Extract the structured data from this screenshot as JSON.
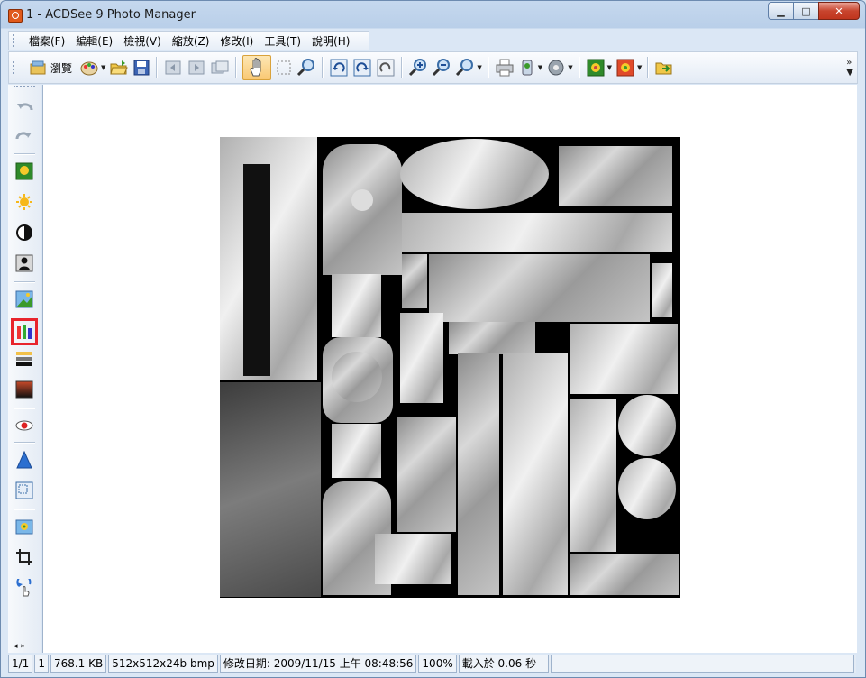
{
  "window": {
    "title": "1 - ACDSee 9 Photo Manager",
    "buttons": {
      "minimize": "▁",
      "maximize": "□",
      "close": "✕"
    }
  },
  "menu": [
    "檔案(F)",
    "編輯(E)",
    "檢視(V)",
    "縮放(Z)",
    "修改(I)",
    "工具(T)",
    "說明(H)"
  ],
  "toolbar": {
    "browse_label": "瀏覽",
    "icons": [
      "browse-icon",
      "palette-icon",
      "open-folder-icon",
      "save-icon",
      "prev-image-icon",
      "next-image-icon",
      "slideshow-icon",
      "hand-tool-icon",
      "select-tool-icon",
      "magnifier-tool-icon",
      "rotate-left-icon",
      "rotate-right-icon",
      "auto-rotate-icon",
      "zoom-in-icon",
      "zoom-out-icon",
      "zoom-icon",
      "print-icon",
      "edit-image-icon",
      "audio-icon",
      "wallpaper-icon",
      "wallpaper-tile-icon",
      "export-icon",
      "more-icon"
    ]
  },
  "sidebar": {
    "icons": [
      "undo-icon",
      "redo-icon",
      "exposure-icon",
      "brightness-icon",
      "contrast-icon",
      "shadow-icon",
      "sharpen-icon",
      "color-balance-icon",
      "levels-icon",
      "curves-icon",
      "red-eye-icon",
      "effects-icon",
      "resize-icon",
      "photo-icon",
      "crop-icon",
      "rotate-hand-icon"
    ],
    "highlighted": "color-balance-icon"
  },
  "status": {
    "index": "1/1",
    "selected": "1",
    "size": "768.1 KB",
    "dimensions": "512x512x24b bmp",
    "modified": "修改日期: 2009/11/15 上午 08:48:56",
    "zoom": "100%",
    "loaded": "載入於 0.06 秒"
  },
  "colors": {
    "highlight": "#e8242c",
    "canvas": "#ffffff",
    "chrome": "#c5d8ee"
  }
}
